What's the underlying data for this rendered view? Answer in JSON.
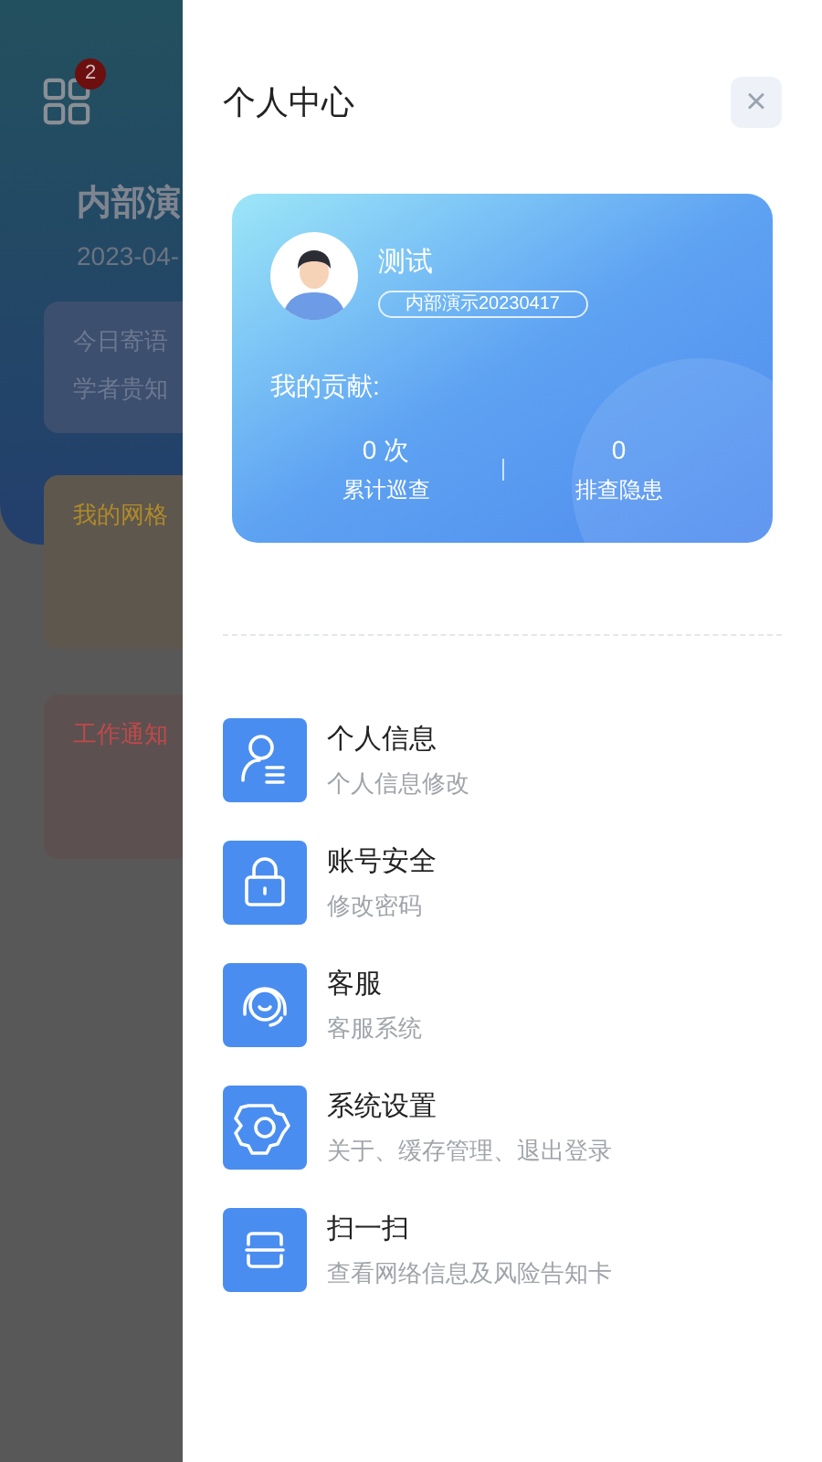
{
  "background": {
    "badge": "2",
    "title": "内部演",
    "date": "2023-04-",
    "cards": [
      {
        "kind": "quote",
        "lines": [
          "今日寄语",
          "学者贵知"
        ]
      },
      {
        "kind": "grid",
        "lines": [
          "我的网格"
        ]
      },
      {
        "kind": "notice",
        "lines": [
          "工作通知"
        ]
      }
    ]
  },
  "drawer": {
    "title": "个人中心",
    "close": "×",
    "profile": {
      "name": "测试",
      "org": "内部演示20230417",
      "contribution_label": "我的贡献:",
      "stats": [
        {
          "value": "0 次",
          "label": "累计巡查"
        },
        {
          "value": "0",
          "label": "排查隐患"
        }
      ]
    },
    "menu": [
      {
        "kind": "person",
        "title": "个人信息",
        "subtitle": "个人信息修改"
      },
      {
        "kind": "lock",
        "title": "账号安全",
        "subtitle": "修改密码"
      },
      {
        "kind": "service",
        "title": "客服",
        "subtitle": "客服系统"
      },
      {
        "kind": "gear",
        "title": "系统设置",
        "subtitle": "关于、缓存管理、退出登录"
      },
      {
        "kind": "scan",
        "title": "扫一扫",
        "subtitle": "查看网络信息及风险告知卡"
      }
    ]
  }
}
